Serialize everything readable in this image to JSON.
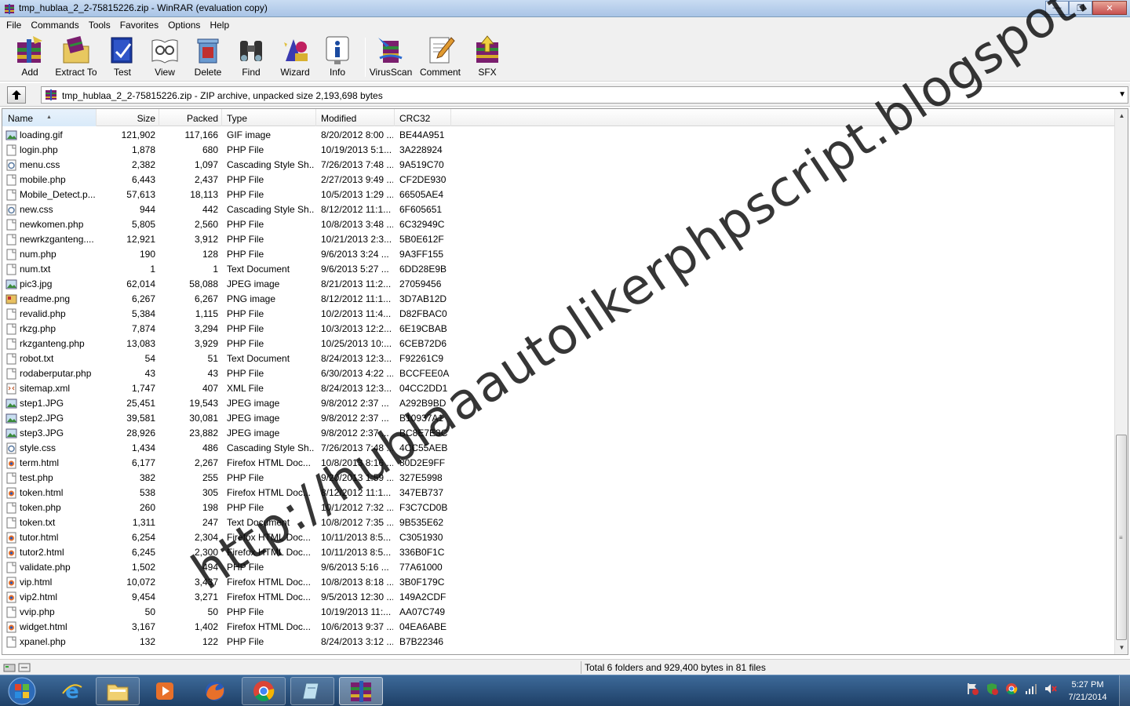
{
  "window": {
    "title": "tmp_hublaa_2_2-75815226.zip - WinRAR (evaluation copy)"
  },
  "menu": [
    "File",
    "Commands",
    "Tools",
    "Favorites",
    "Options",
    "Help"
  ],
  "toolbar": {
    "buttons": [
      {
        "label": "Add",
        "icon": "add-archive-icon"
      },
      {
        "label": "Extract To",
        "icon": "extract-to-icon"
      },
      {
        "label": "Test",
        "icon": "test-icon"
      },
      {
        "label": "View",
        "icon": "view-icon"
      },
      {
        "label": "Delete",
        "icon": "delete-icon"
      },
      {
        "label": "Find",
        "icon": "find-binoculars-icon"
      },
      {
        "label": "Wizard",
        "icon": "wizard-icon"
      },
      {
        "label": "Info",
        "icon": "info-icon"
      },
      {
        "label": "VirusScan",
        "icon": "virusscan-icon"
      },
      {
        "label": "Comment",
        "icon": "comment-icon"
      },
      {
        "label": "SFX",
        "icon": "sfx-icon"
      }
    ]
  },
  "address": {
    "text": "tmp_hublaa_2_2-75815226.zip - ZIP archive, unpacked size 2,193,698 bytes"
  },
  "columns": [
    "Name",
    "Size",
    "Packed",
    "Type",
    "Modified",
    "CRC32"
  ],
  "files": [
    {
      "name": "loading.gif",
      "size": "121,902",
      "packed": "117,166",
      "type": "GIF image",
      "modified": "8/20/2012 8:00 ...",
      "crc": "BE44A951",
      "icon": "image"
    },
    {
      "name": "login.php",
      "size": "1,878",
      "packed": "680",
      "type": "PHP File",
      "modified": "10/19/2013 5:1...",
      "crc": "3A228924",
      "icon": "doc"
    },
    {
      "name": "menu.css",
      "size": "2,382",
      "packed": "1,097",
      "type": "Cascading Style Sh...",
      "modified": "7/26/2013 7:48 ...",
      "crc": "9A519C70",
      "icon": "css"
    },
    {
      "name": "mobile.php",
      "size": "6,443",
      "packed": "2,437",
      "type": "PHP File",
      "modified": "2/27/2013 9:49 ...",
      "crc": "CF2DE930",
      "icon": "doc"
    },
    {
      "name": "Mobile_Detect.p...",
      "size": "57,613",
      "packed": "18,113",
      "type": "PHP File",
      "modified": "10/5/2013 1:29 ...",
      "crc": "66505AE4",
      "icon": "doc"
    },
    {
      "name": "new.css",
      "size": "944",
      "packed": "442",
      "type": "Cascading Style Sh...",
      "modified": "8/12/2012 11:1...",
      "crc": "6F605651",
      "icon": "css"
    },
    {
      "name": "newkomen.php",
      "size": "5,805",
      "packed": "2,560",
      "type": "PHP File",
      "modified": "10/8/2013 3:48 ...",
      "crc": "6C32949C",
      "icon": "doc"
    },
    {
      "name": "newrkzganteng....",
      "size": "12,921",
      "packed": "3,912",
      "type": "PHP File",
      "modified": "10/21/2013 2:3...",
      "crc": "5B0E612F",
      "icon": "doc"
    },
    {
      "name": "num.php",
      "size": "190",
      "packed": "128",
      "type": "PHP File",
      "modified": "9/6/2013 3:24 ...",
      "crc": "9A3FF155",
      "icon": "doc"
    },
    {
      "name": "num.txt",
      "size": "1",
      "packed": "1",
      "type": "Text Document",
      "modified": "9/6/2013 5:27 ...",
      "crc": "6DD28E9B",
      "icon": "doc"
    },
    {
      "name": "pic3.jpg",
      "size": "62,014",
      "packed": "58,088",
      "type": "JPEG image",
      "modified": "8/21/2013 11:2...",
      "crc": "27059456",
      "icon": "image"
    },
    {
      "name": "readme.png",
      "size": "6,267",
      "packed": "6,267",
      "type": "PNG image",
      "modified": "8/12/2012 11:1...",
      "crc": "3D7AB12D",
      "icon": "png"
    },
    {
      "name": "revalid.php",
      "size": "5,384",
      "packed": "1,115",
      "type": "PHP File",
      "modified": "10/2/2013 11:4...",
      "crc": "D82FBAC0",
      "icon": "doc"
    },
    {
      "name": "rkzg.php",
      "size": "7,874",
      "packed": "3,294",
      "type": "PHP File",
      "modified": "10/3/2013 12:2...",
      "crc": "6E19CBAB",
      "icon": "doc"
    },
    {
      "name": "rkzganteng.php",
      "size": "13,083",
      "packed": "3,929",
      "type": "PHP File",
      "modified": "10/25/2013 10:...",
      "crc": "6CEB72D6",
      "icon": "doc"
    },
    {
      "name": "robot.txt",
      "size": "54",
      "packed": "51",
      "type": "Text Document",
      "modified": "8/24/2013 12:3...",
      "crc": "F92261C9",
      "icon": "doc"
    },
    {
      "name": "rodaberputar.php",
      "size": "43",
      "packed": "43",
      "type": "PHP File",
      "modified": "6/30/2013 4:22 ...",
      "crc": "BCCFEE0A",
      "icon": "doc"
    },
    {
      "name": "sitemap.xml",
      "size": "1,747",
      "packed": "407",
      "type": "XML File",
      "modified": "8/24/2013 12:3...",
      "crc": "04CC2DD1",
      "icon": "xml"
    },
    {
      "name": "step1.JPG",
      "size": "25,451",
      "packed": "19,543",
      "type": "JPEG image",
      "modified": "9/8/2012 2:37 ...",
      "crc": "A292B9BD",
      "icon": "image"
    },
    {
      "name": "step2.JPG",
      "size": "39,581",
      "packed": "30,081",
      "type": "JPEG image",
      "modified": "9/8/2012 2:37 ...",
      "crc": "B10937A1",
      "icon": "image"
    },
    {
      "name": "step3.JPG",
      "size": "28,926",
      "packed": "23,882",
      "type": "JPEG image",
      "modified": "9/8/2012 2:37 ...",
      "crc": "BC8E7E3C",
      "icon": "image"
    },
    {
      "name": "style.css",
      "size": "1,434",
      "packed": "486",
      "type": "Cascading Style Sh...",
      "modified": "7/26/2013 7:48 ...",
      "crc": "4CC55AEB",
      "icon": "css"
    },
    {
      "name": "term.html",
      "size": "6,177",
      "packed": "2,267",
      "type": "Firefox HTML Doc...",
      "modified": "10/8/2013 8:16 ...",
      "crc": "80D2E9FF",
      "icon": "html"
    },
    {
      "name": "test.php",
      "size": "382",
      "packed": "255",
      "type": "PHP File",
      "modified": "9/20/2013 1:59 ...",
      "crc": "327E5998",
      "icon": "doc"
    },
    {
      "name": "token.html",
      "size": "538",
      "packed": "305",
      "type": "Firefox HTML Doc...",
      "modified": "8/12/2012 11:1...",
      "crc": "347EB737",
      "icon": "html"
    },
    {
      "name": "token.php",
      "size": "260",
      "packed": "198",
      "type": "PHP File",
      "modified": "10/1/2012 7:32 ...",
      "crc": "F3C7CD0B",
      "icon": "doc"
    },
    {
      "name": "token.txt",
      "size": "1,311",
      "packed": "247",
      "type": "Text Document",
      "modified": "10/8/2012 7:35 ...",
      "crc": "9B535E62",
      "icon": "doc"
    },
    {
      "name": "tutor.html",
      "size": "6,254",
      "packed": "2,304",
      "type": "Firefox HTML Doc...",
      "modified": "10/11/2013 8:5...",
      "crc": "C3051930",
      "icon": "html"
    },
    {
      "name": "tutor2.html",
      "size": "6,245",
      "packed": "2,300",
      "type": "Firefox HTML Doc...",
      "modified": "10/11/2013 8:5...",
      "crc": "336B0F1C",
      "icon": "html"
    },
    {
      "name": "validate.php",
      "size": "1,502",
      "packed": "494",
      "type": "PHP File",
      "modified": "9/6/2013 5:16 ...",
      "crc": "77A61000",
      "icon": "doc"
    },
    {
      "name": "vip.html",
      "size": "10,072",
      "packed": "3,437",
      "type": "Firefox HTML Doc...",
      "modified": "10/8/2013 8:18 ...",
      "crc": "3B0F179C",
      "icon": "html"
    },
    {
      "name": "vip2.html",
      "size": "9,454",
      "packed": "3,271",
      "type": "Firefox HTML Doc...",
      "modified": "9/5/2013 12:30 ...",
      "crc": "149A2CDF",
      "icon": "html"
    },
    {
      "name": "vvip.php",
      "size": "50",
      "packed": "50",
      "type": "PHP File",
      "modified": "10/19/2013 11:...",
      "crc": "AA07C749",
      "icon": "doc"
    },
    {
      "name": "widget.html",
      "size": "3,167",
      "packed": "1,402",
      "type": "Firefox HTML Doc...",
      "modified": "10/6/2013 9:37 ...",
      "crc": "04EA6ABE",
      "icon": "html"
    },
    {
      "name": "xpanel.php",
      "size": "132",
      "packed": "122",
      "type": "PHP File",
      "modified": "8/24/2013 3:12 ...",
      "crc": "B7B22346",
      "icon": "doc"
    }
  ],
  "status": {
    "text": "Total 6 folders and 929,400 bytes in 81 files"
  },
  "watermark": "http://hublaaautolikerphpscript.blogspot.com/",
  "taskbar": {
    "apps": [
      "internet-explorer-icon",
      "file-explorer-icon",
      "media-player-icon",
      "firefox-icon",
      "chrome-icon",
      "notepad-icon",
      "winrar-icon"
    ],
    "tray": [
      "flag-icon",
      "shield-icon",
      "chrome-tray-icon",
      "network-icon",
      "volume-muted-icon"
    ],
    "time": "5:27 PM",
    "date": "7/21/2014"
  },
  "colors": {
    "titlebar": "#a9c4e6",
    "taskbar": "#2a4f7c",
    "header_sorted": "#d9eaf9"
  }
}
